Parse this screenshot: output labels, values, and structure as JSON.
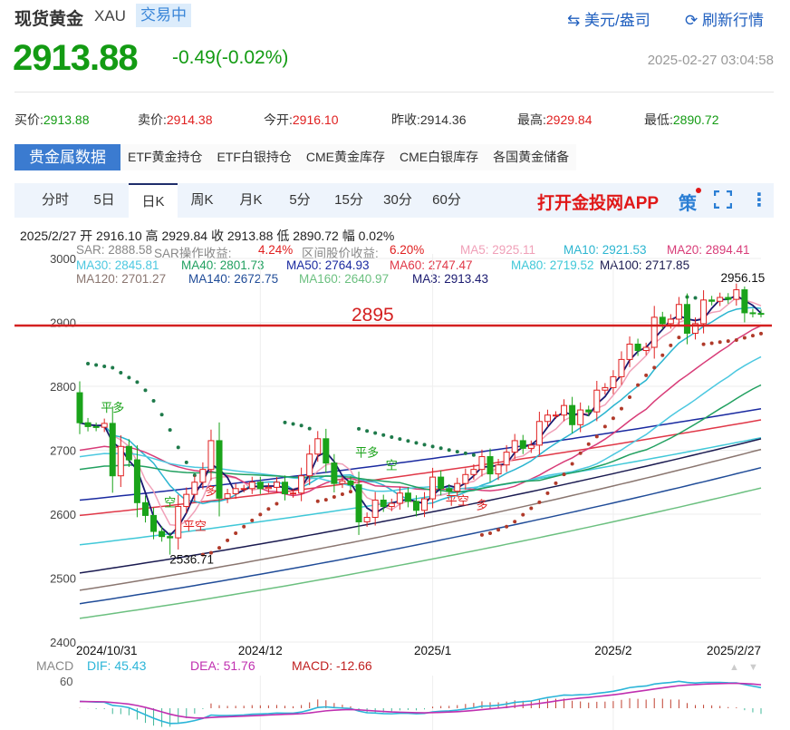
{
  "header": {
    "title": "现货黄金",
    "symbol": "XAU",
    "status": "交易中",
    "unit_link": "美元/盎司",
    "refresh_link": "刷新行情",
    "price": "2913.88",
    "change": "-0.49(-0.02%)",
    "timestamp": "2025-02-27 03:04:58"
  },
  "quotes": [
    {
      "label": "买价:",
      "value": "2913.88",
      "tone": "g"
    },
    {
      "label": "卖价:",
      "value": "2914.38",
      "tone": "r"
    },
    {
      "label": "今开:",
      "value": "2916.10",
      "tone": "r"
    },
    {
      "label": "昨收:",
      "value": "2914.36",
      "tone": ""
    },
    {
      "label": "最高:",
      "value": "2929.84",
      "tone": "r"
    },
    {
      "label": "最低:",
      "value": "2890.72",
      "tone": "g"
    }
  ],
  "data_tabs": [
    "贵金属数据",
    "ETF黄金持仓",
    "ETF白银持仓",
    "CME黄金库存",
    "CME白银库存",
    "各国黄金储备"
  ],
  "period_tabs": [
    "分时",
    "5日",
    "日K",
    "周K",
    "月K",
    "5分",
    "15分",
    "30分",
    "60分"
  ],
  "active_period": "日K",
  "app_banner": "打开金投网APP",
  "strategy_label": "策",
  "info_line": "2025/2/27  开 2916.10  高 2929.84  收 2913.88  低 2890.72  幅 0.02%",
  "legend": [
    [
      {
        "t": "SAR: 2888.58",
        "c": "#888"
      },
      {
        "t": "SAR操作收益: ",
        "c": "#888"
      },
      {
        "t": "4.24%",
        "c": "#e02020"
      },
      {
        "t": "区间股价收益: ",
        "c": "#888"
      },
      {
        "t": "6.20%",
        "c": "#e02020"
      },
      {
        "t": "MA5: 2925.11",
        "c": "#f0a0b8"
      },
      {
        "t": "MA10: 2921.53",
        "c": "#2bb5d0"
      },
      {
        "t": "MA20: 2894.41",
        "c": "#d83c78"
      }
    ],
    [
      {
        "t": "MA30: 2845.81",
        "c": "#4cc8e0"
      },
      {
        "t": "MA40: 2801.73",
        "c": "#21a060"
      },
      {
        "t": "MA50: 2764.93",
        "c": "#1a2aa0"
      },
      {
        "t": "MA60: 2747.47",
        "c": "#e03848"
      },
      {
        "t": "MA80: 2719.52",
        "c": "#40c8d8"
      },
      {
        "t": "MA100: 2717.85",
        "c": "#1a1a50"
      }
    ],
    [
      {
        "t": "MA120: 2701.27",
        "c": "#8a7670"
      },
      {
        "t": "MA140: 2672.75",
        "c": "#204c98"
      },
      {
        "t": "MA160: 2640.97",
        "c": "#6cc080"
      },
      {
        "t": "MA3: 2913.43",
        "c": "#1a1a70"
      }
    ]
  ],
  "colors": {
    "up": "#e02020",
    "down": "#1aa31a",
    "accent": "#3b7bd0",
    "support": "#d42020"
  },
  "chart_data": {
    "type": "candlestick",
    "y_ticks": [
      3000,
      2900,
      2800,
      2700,
      2600,
      2500,
      2400
    ],
    "ylim": [
      2400,
      3000
    ],
    "x_labels": [
      {
        "label": "2024/10/31",
        "index": 0
      },
      {
        "label": "2024/12",
        "index": 22
      },
      {
        "label": "2025/1",
        "index": 43
      },
      {
        "label": "2025/2",
        "index": 65
      },
      {
        "label": "2025/2/27",
        "index": 83
      }
    ],
    "first_open": 2790,
    "closes": [
      2743,
      2737,
      2736,
      2742,
      2660,
      2706,
      2685,
      2618,
      2598,
      2573,
      2565,
      2563,
      2612,
      2631,
      2650,
      2670,
      2715,
      2625,
      2632,
      2640,
      2640,
      2650,
      2640,
      2642,
      2650,
      2632,
      2633,
      2660,
      2694,
      2718,
      2680,
      2648,
      2652,
      2646,
      2588,
      2595,
      2622,
      2612,
      2617,
      2633,
      2620,
      2606,
      2624,
      2658,
      2640,
      2636,
      2648,
      2662,
      2670,
      2690,
      2663,
      2677,
      2697,
      2715,
      2703,
      2708,
      2745,
      2755,
      2755,
      2770,
      2740,
      2763,
      2760,
      2794,
      2798,
      2815,
      2842,
      2866,
      2856,
      2861,
      2908,
      2898,
      2905,
      2928,
      2883,
      2898,
      2935,
      2933,
      2939,
      2936,
      2951,
      2915,
      2914,
      2913.88
    ],
    "long_ma": [
      {
        "name": "MA50",
        "start": 2622,
        "end": 2764.93,
        "color": "#1a2aa0"
      },
      {
        "name": "MA60",
        "start": 2598,
        "end": 2747.47,
        "color": "#e03848"
      },
      {
        "name": "MA80",
        "start": 2552,
        "end": 2719.52,
        "color": "#40c8d8"
      },
      {
        "name": "MA100",
        "start": 2508,
        "end": 2717.85,
        "color": "#1a1a50"
      },
      {
        "name": "MA120",
        "start": 2481,
        "end": 2701.27,
        "color": "#8a7670"
      },
      {
        "name": "MA140",
        "start": 2460,
        "end": 2672.75,
        "color": "#204c98"
      },
      {
        "name": "MA160",
        "start": 2437,
        "end": 2640.97,
        "color": "#6cc080"
      }
    ],
    "short_ma": [
      {
        "name": "MA5",
        "period": 5,
        "color": "#f0a0b8"
      },
      {
        "name": "MA10",
        "period": 10,
        "color": "#2bb5d0"
      },
      {
        "name": "MA20",
        "period": 20,
        "color": "#d83c78"
      },
      {
        "name": "MA30",
        "period": 30,
        "color": "#4cc8e0"
      },
      {
        "name": "MA40",
        "period": 40,
        "color": "#21a060"
      },
      {
        "name": "MA3",
        "period": 3,
        "color": "#1a1a70"
      }
    ],
    "support_line": {
      "value": 2895,
      "label": "2895"
    },
    "high_label": {
      "value": 2956.15,
      "label": "2956.15",
      "index": 81
    },
    "low_label": {
      "value": 2536.71,
      "label": "2536.71",
      "index": 11
    },
    "signals": [
      {
        "label": "平多",
        "index": 4,
        "value": 2760,
        "color": "#1aa31a"
      },
      {
        "label": "空",
        "index": 11,
        "value": 2612,
        "color": "#1aa31a"
      },
      {
        "label": "平空",
        "index": 14,
        "value": 2575,
        "color": "#e02020"
      },
      {
        "label": "多",
        "index": 16,
        "value": 2630,
        "color": "#e02020"
      },
      {
        "label": "平多",
        "index": 35,
        "value": 2690,
        "color": "#1aa31a"
      },
      {
        "label": "空",
        "index": 38,
        "value": 2670,
        "color": "#1aa31a"
      },
      {
        "label": "平空",
        "index": 46,
        "value": 2615,
        "color": "#e02020"
      },
      {
        "label": "多",
        "index": 49,
        "value": 2608,
        "color": "#e02020"
      }
    ]
  },
  "macd": {
    "label": "MACD",
    "dif": "DIF: 45.43",
    "dea": "DEA: 51.76",
    "macd": "MACD: -12.66",
    "tick": "60",
    "dif_color": "#2bb5d8",
    "dea_color": "#c030b0",
    "macd_color": "#c02020"
  }
}
